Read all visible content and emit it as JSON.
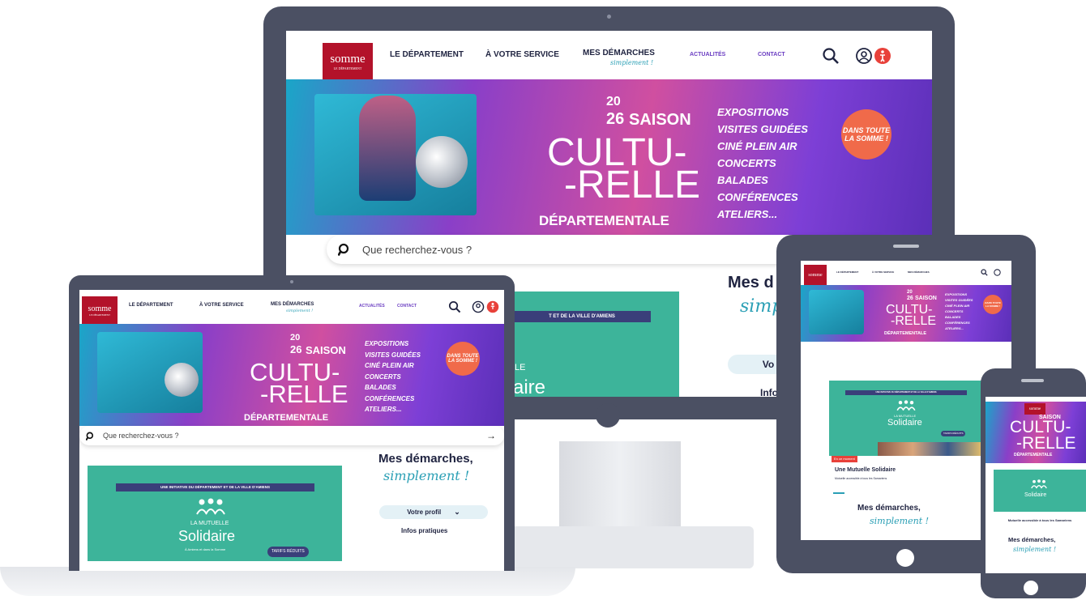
{
  "brand": {
    "logo_text": "somme",
    "logo_sub": "LE DÉPARTEMENT"
  },
  "nav": {
    "items": [
      "LE DÉPARTEMENT",
      "À VOTRE SERVICE",
      "MES DÉMARCHES"
    ],
    "sub_label": "simplement !",
    "secondary": [
      "ACTUALITÉS",
      "CONTACT"
    ]
  },
  "hero": {
    "year_top": "20",
    "year_bottom": "26",
    "saison": "SAISON",
    "line1": "CULTU-",
    "line2": "-RELLE",
    "line3": "DÉPARTEMENTALE",
    "list": [
      "EXPOSITIONS",
      "VISITES GUIDÉES",
      "CINÉ PLEIN AIR",
      "CONCERTS",
      "BALADES",
      "CONFÉRENCES",
      "ATELIERS..."
    ],
    "badge": "DANS TOUTE LA SOMME !"
  },
  "search": {
    "placeholder": "Que recherchez-vous ?"
  },
  "mutuelle": {
    "initiative": "UNE INITIATIVE DU DÉPARTEMENT ET DE LA VILLE D'AMIENS",
    "initiative_partial": "T ET DE LA VILLE D'AMIENS",
    "small": "LA MUTUELLE",
    "big": "Solidaire",
    "big_partial": "aire",
    "partial_le": "LE",
    "tagline": "À Amiens et dans la Somme",
    "cta": "TARIFS RÉDUITS",
    "news_tag": "En ce moment",
    "news_title": "Une Mutuelle Solidaire",
    "news_text": "Mutuelle accessible à tous les Samariens"
  },
  "demarches": {
    "title": "Mes démarches,",
    "title_partial": "Mes d",
    "sub": "simplement !",
    "sub_partial": "simp",
    "profile": "Votre profil",
    "profile_partial": "Vo",
    "infos": "Infos pratiques",
    "infos_partial": "Info"
  },
  "colors": {
    "brand_red": "#b3122a",
    "navy": "#1f2340",
    "green": "#3db49a",
    "purple": "#8a3fc8",
    "orange": "#f06a4a",
    "device": "#4b5063"
  }
}
